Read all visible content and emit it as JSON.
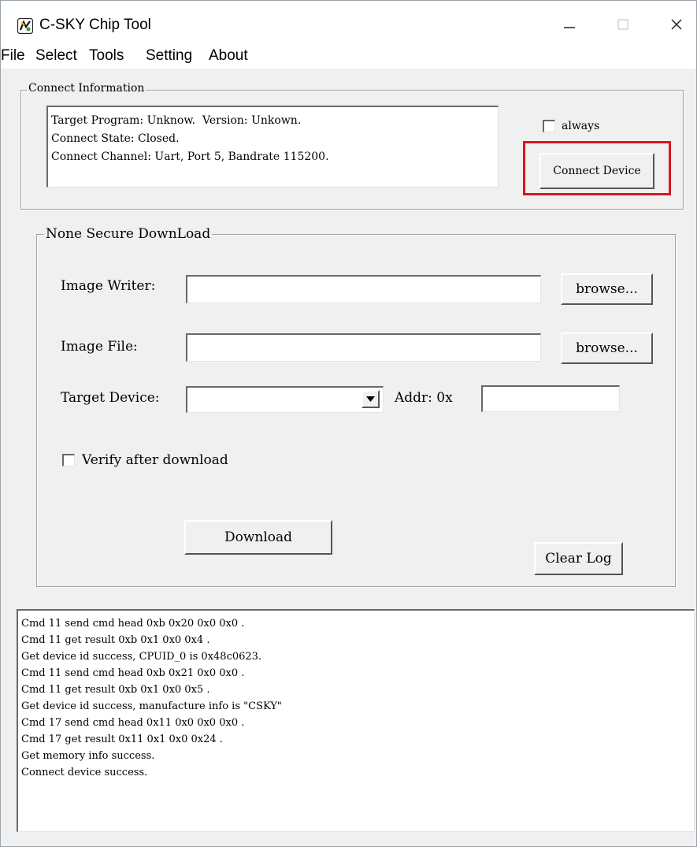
{
  "window": {
    "title": "C-SKY Chip Tool",
    "icon": "app-logo-icon",
    "controls": {
      "minimize": "minimize-icon",
      "maximize": "maximize-icon",
      "close": "close-icon"
    }
  },
  "menu": [
    "File",
    "Select",
    "Tools",
    "Setting",
    "About"
  ],
  "connect": {
    "legend": "Connect Information",
    "info_lines": [
      "Target Program: Unknow.  Version: Unkown.",
      "Connect State: Closed.",
      "Connect Channel: Uart, Port 5, Bandrate 115200."
    ],
    "always_label": "always",
    "always_checked": false,
    "connect_button": "Connect Device",
    "highlight_color": "#d9161c"
  },
  "download": {
    "legend": "None Secure DownLoad",
    "image_writer_label": "Image Writer:",
    "image_writer_value": "",
    "image_file_label": "Image File:",
    "image_file_value": "",
    "browse_label": "browse...",
    "target_device_label": "Target Device:",
    "target_device_value": "",
    "addr_label": "Addr: 0x",
    "addr_value": "",
    "verify_label": "Verify after download",
    "verify_checked": false,
    "download_button": "Download",
    "clear_log_button": "Clear Log"
  },
  "log": [
    "Cmd 11 send cmd head 0xb 0x20 0x0 0x0 .",
    "Cmd 11 get result 0xb 0x1 0x0 0x4 .",
    "Get device id success, CPUID_0 is 0x48c0623.",
    "Cmd 11 send cmd head 0xb 0x21 0x0 0x0 .",
    "Cmd 11 get result 0xb 0x1 0x0 0x5 .",
    "Get device id success, manufacture info is \"CSKY\"",
    "Cmd 17 send cmd head 0x11 0x0 0x0 0x0 .",
    "Cmd 17 get result 0x11 0x1 0x0 0x24 .",
    "Get memory info success.",
    "Connect device success."
  ]
}
